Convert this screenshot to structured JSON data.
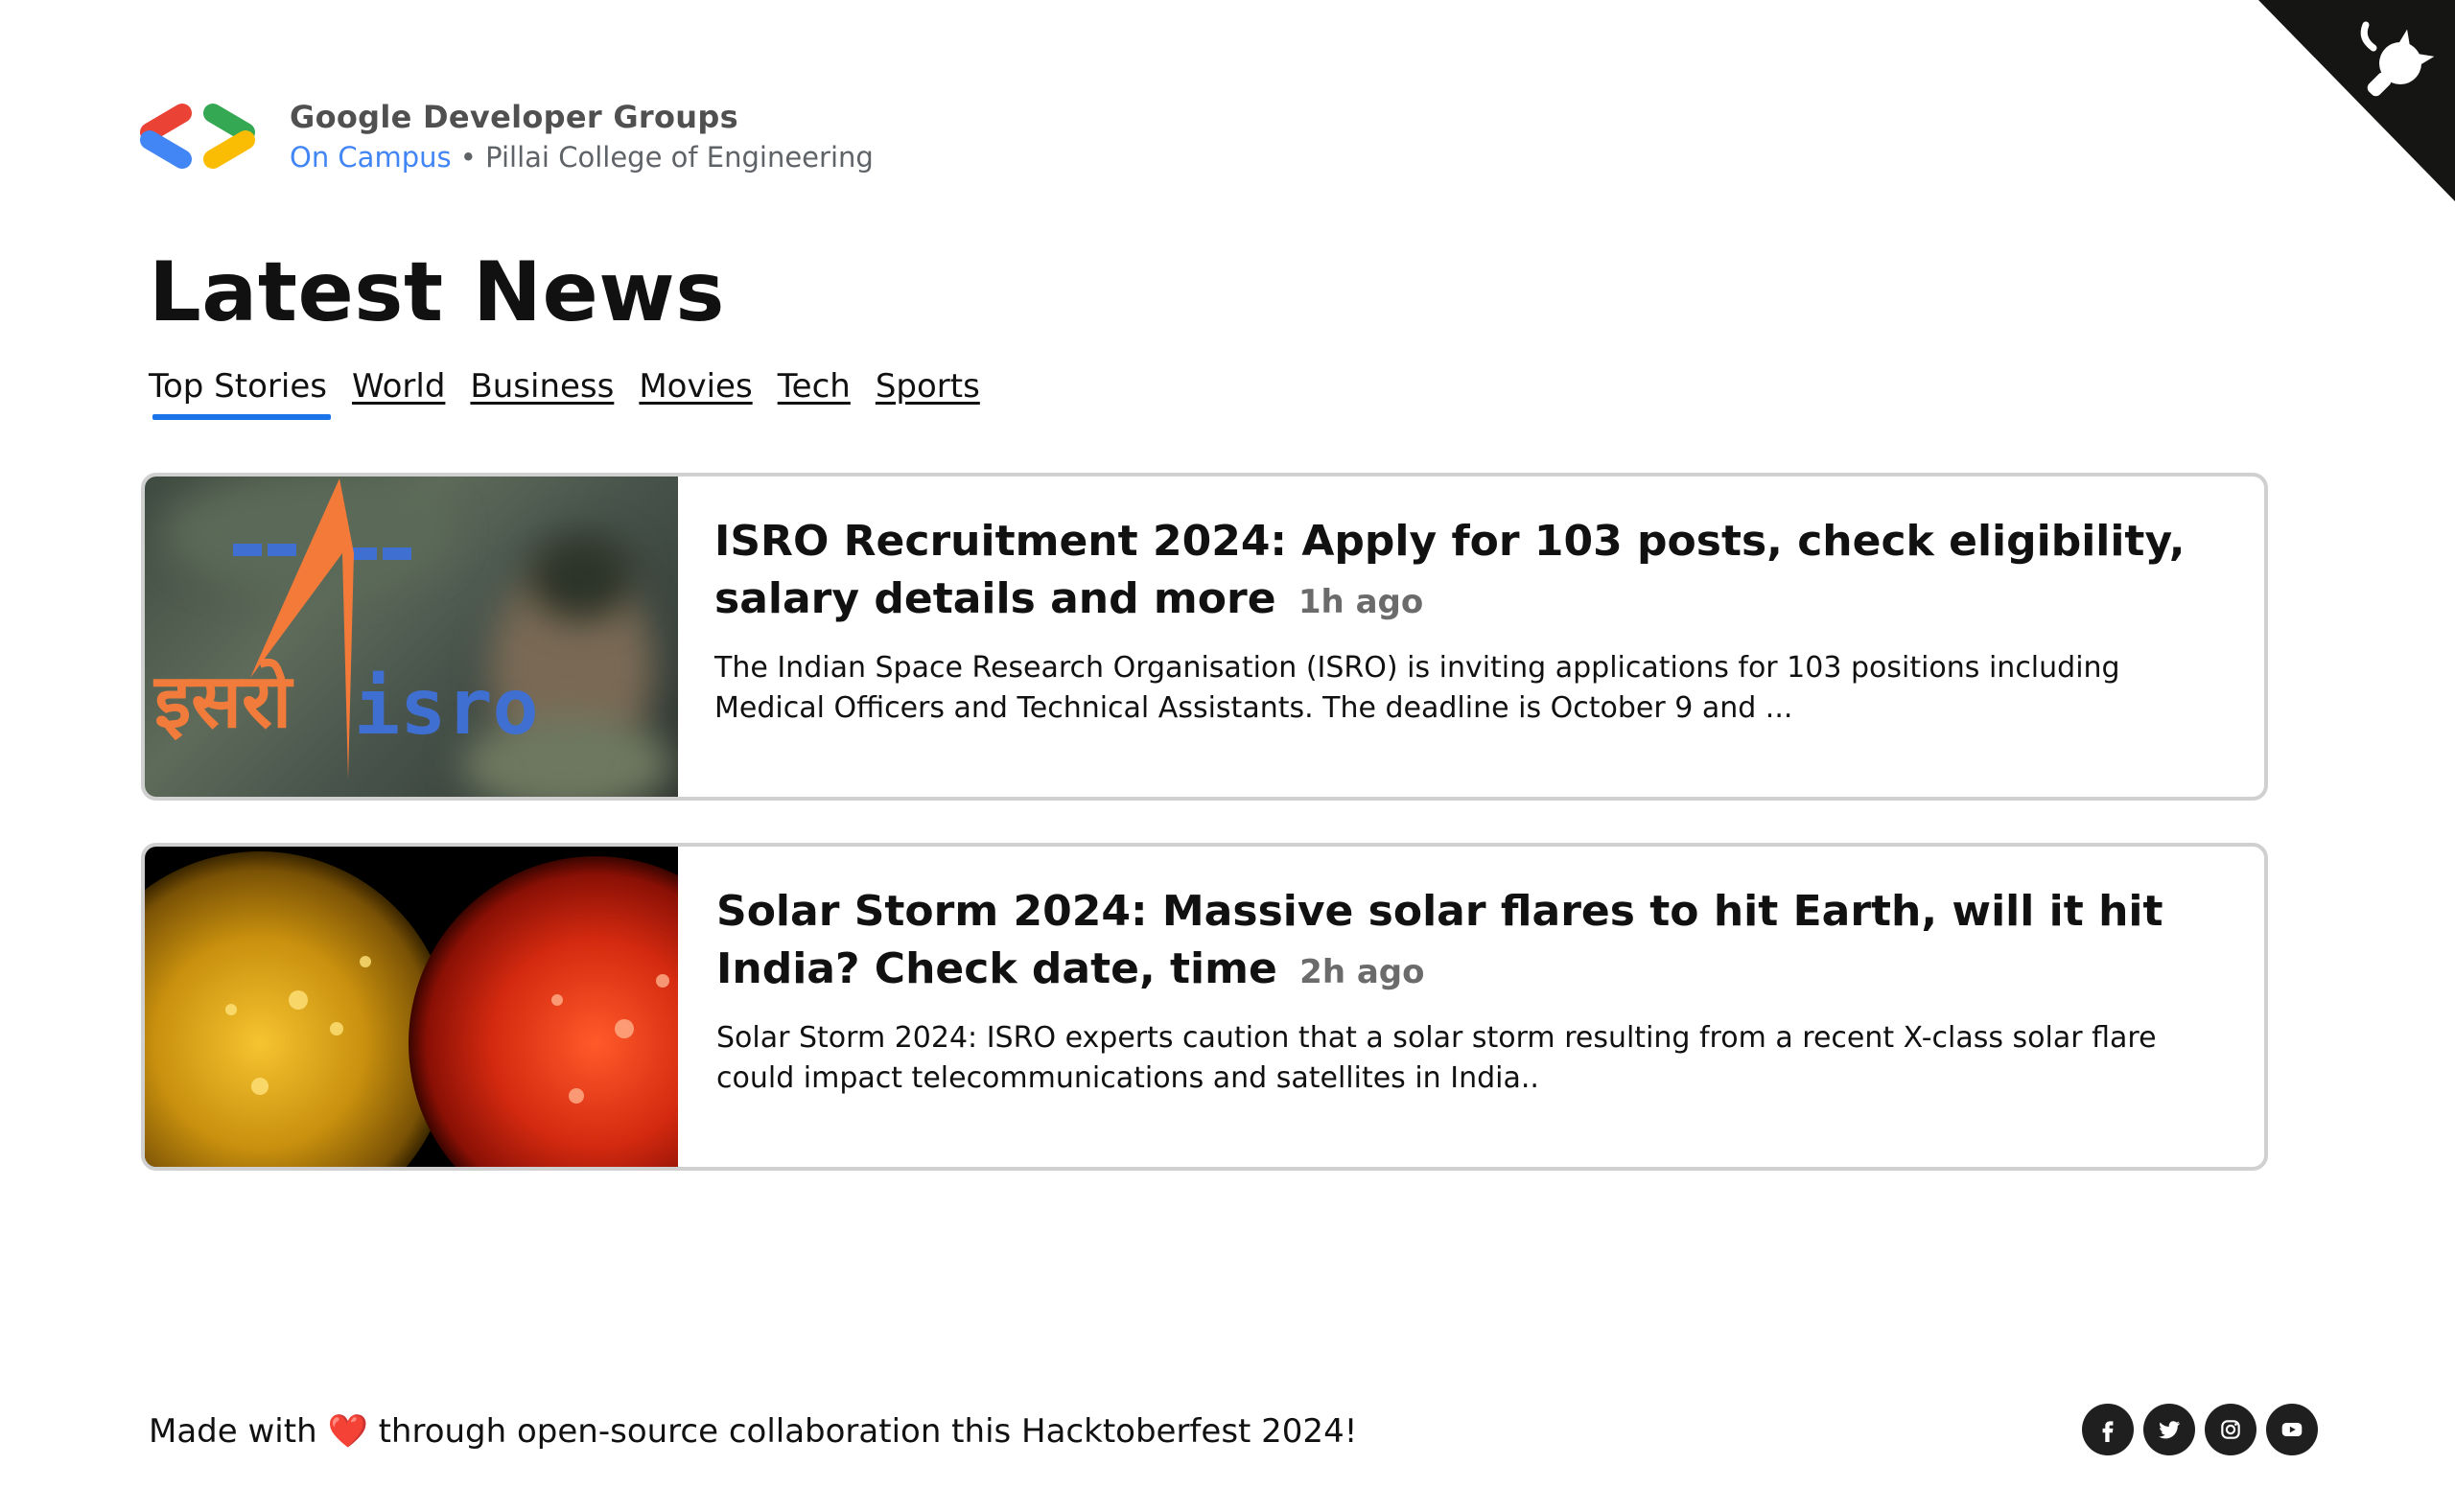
{
  "brand": {
    "title": "Google Developer Groups",
    "campus": "On Campus",
    "separator": " • ",
    "college": "Pillai College of Engineering"
  },
  "page_title": "Latest News",
  "tabs": [
    {
      "label": "Top Stories",
      "active": true
    },
    {
      "label": "World"
    },
    {
      "label": "Business"
    },
    {
      "label": "Movies"
    },
    {
      "label": "Tech"
    },
    {
      "label": "Sports"
    }
  ],
  "articles": [
    {
      "headline": "ISRO Recruitment 2024: Apply for 103 posts, check eligibility, salary details and more",
      "time": "1h ago",
      "description": "The Indian Space Research Organisation (ISRO) is inviting applications for 103 positions including Medical Officers and Technical Assistants. The deadline is October 9 and ...",
      "image_text_hindi": "इसरो",
      "image_text_latin": "isro"
    },
    {
      "headline": "Solar Storm 2024: Massive solar flares to hit Earth, will it hit India? Check date, time",
      "time": "2h ago",
      "description": "Solar Storm 2024: ISRO experts caution that a solar storm resulting from a recent X-class solar flare could impact telecommunications and satellites in India.."
    }
  ],
  "footer": {
    "prefix": "Made with",
    "heart": "❤️",
    "suffix": "through open-source collaboration this Hacktoberfest 2024!"
  },
  "socials": [
    "facebook-icon",
    "twitter-icon",
    "instagram-icon",
    "youtube-icon"
  ],
  "colors": {
    "accent": "#1a73e8",
    "google_blue": "#4285f4",
    "google_red": "#ea4335",
    "google_green": "#34a853",
    "google_yellow": "#fbbc04"
  }
}
